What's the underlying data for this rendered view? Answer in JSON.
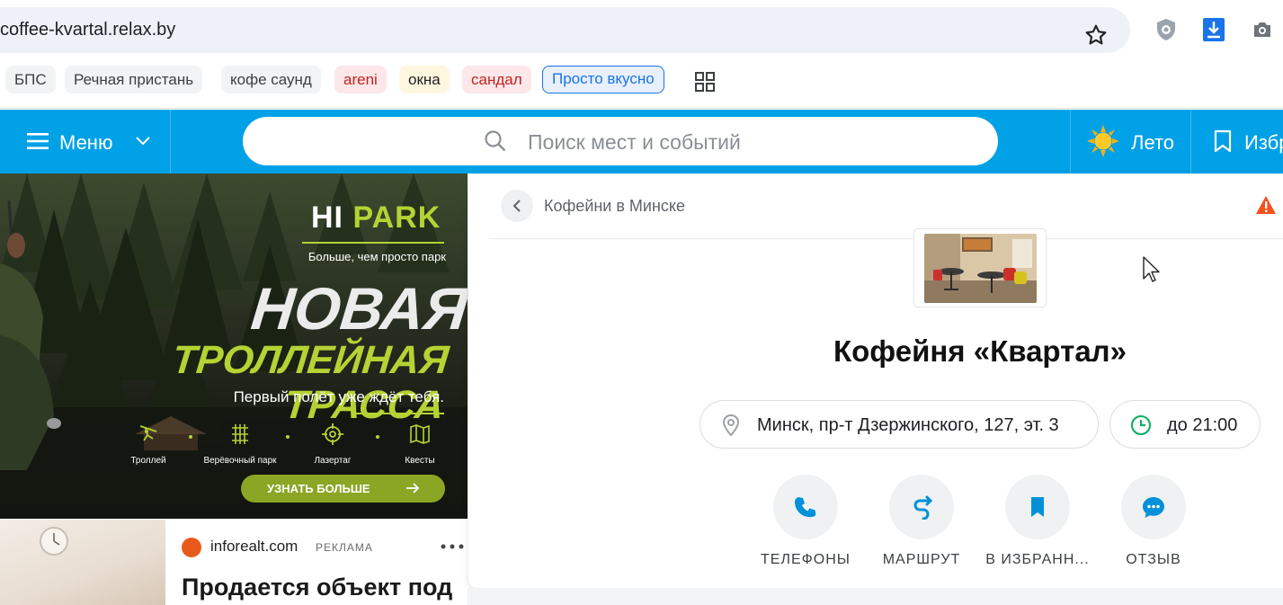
{
  "browser": {
    "url": "coffee-kvartal.relax.by",
    "bookmarks": [
      {
        "label": "БПС"
      },
      {
        "label": "Речная пристань"
      },
      {
        "label": "кофе саунд"
      },
      {
        "label": "areni"
      },
      {
        "label": "окна"
      },
      {
        "label": "сандал"
      },
      {
        "label": "Просто вкусно"
      }
    ]
  },
  "header": {
    "menu_label": "Меню",
    "search_placeholder": "Поиск мест и событий",
    "season_label": "Лето",
    "favorites_label": "Избранное"
  },
  "banner": {
    "logo_hi": "HI",
    "logo_park": "PARK",
    "tagline": "Больше, чем просто парк",
    "headline_1": "НОВАЯ",
    "headline_2": "ТРОЛЛЕЙНАЯ ТРАССА",
    "subline": "Первый полёт уже ждёт тебя.",
    "features": [
      "Троллей",
      "Верёвочный парк",
      "Лазертаг",
      "Квесты"
    ],
    "cta": "УЗНАТЬ БОЛЬШЕ"
  },
  "ad2": {
    "source": "inforealt.com",
    "tag": "РЕКЛАМА",
    "title": "Продается объект под"
  },
  "place": {
    "breadcrumb": "Кофейни в Минске",
    "title": "Кофейня «Квартал»",
    "address": "Минск, пр-т Дзержинского, 127, эт. 3",
    "hours": "до 21:00",
    "actions": [
      "ТЕЛЕФОНЫ",
      "МАРШРУТ",
      "В ИЗБРАНН...",
      "ОТЗЫВ"
    ]
  },
  "colors": {
    "brand_blue": "#00a1e6",
    "park_green": "#b4d334",
    "action_icon": "#0091d8",
    "hours_icon": "#15b06c",
    "warning": "#f4511e"
  }
}
